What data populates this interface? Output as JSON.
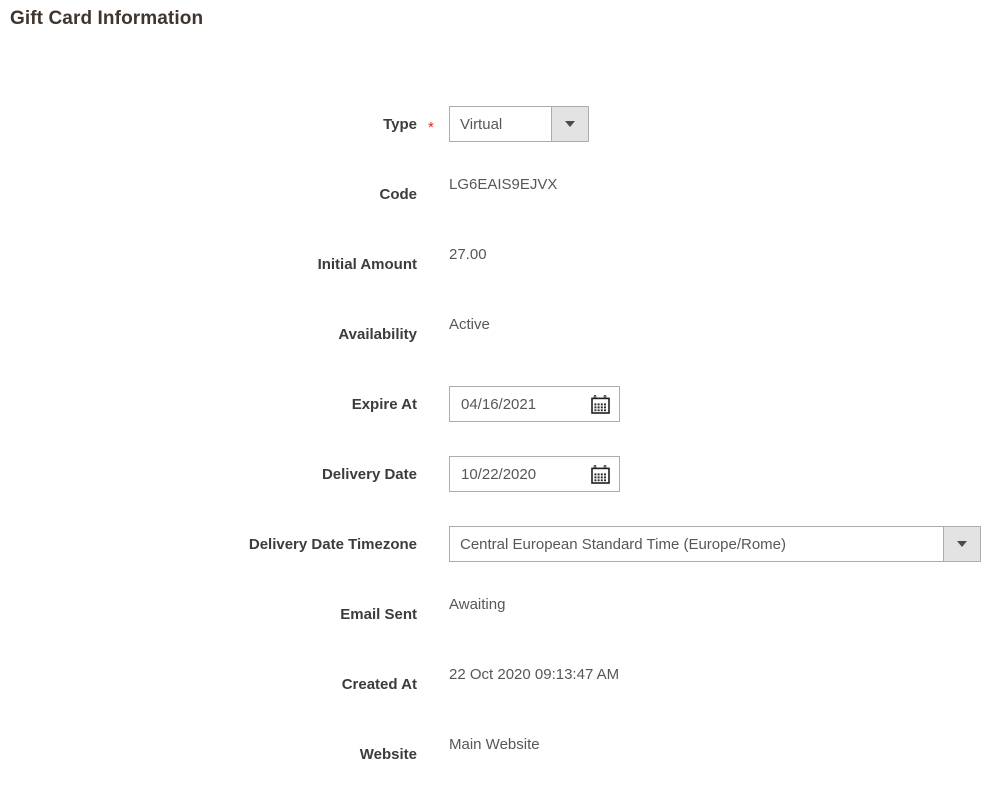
{
  "page": {
    "title": "Gift Card Information"
  },
  "form": {
    "required_marker": "*",
    "fields": [
      {
        "name": "type",
        "label": "Type",
        "required": true,
        "control": "select",
        "value": "Virtual"
      },
      {
        "name": "code",
        "label": "Code",
        "required": false,
        "control": "text",
        "value": "LG6EAIS9EJVX"
      },
      {
        "name": "initial-amount",
        "label": "Initial Amount",
        "required": false,
        "control": "text",
        "value": "27.00"
      },
      {
        "name": "availability",
        "label": "Availability",
        "required": false,
        "control": "text",
        "value": "Active"
      },
      {
        "name": "expire-at",
        "label": "Expire At",
        "required": false,
        "control": "date",
        "value": "04/16/2021",
        "icon": "calendar-icon"
      },
      {
        "name": "delivery-date",
        "label": "Delivery Date",
        "required": false,
        "control": "date",
        "value": "10/22/2020",
        "icon": "calendar-icon"
      },
      {
        "name": "delivery-date-timezone",
        "label": "Delivery Date Timezone",
        "required": false,
        "control": "select",
        "value": "Central European Standard Time (Europe/Rome)"
      },
      {
        "name": "email-sent",
        "label": "Email Sent",
        "required": false,
        "control": "text",
        "value": "Awaiting"
      },
      {
        "name": "created-at",
        "label": "Created At",
        "required": false,
        "control": "text",
        "value": "22 Oct 2020 09:13:47 AM"
      },
      {
        "name": "website",
        "label": "Website",
        "required": false,
        "control": "text",
        "value": "Main Website"
      }
    ]
  },
  "colors": {
    "title": "#41362f",
    "label": "#3c3c3c",
    "value": "#575757",
    "required": "#e22626",
    "border": "#adadad",
    "arrow_bg": "#e3e3e3",
    "background": "#ffffff"
  }
}
